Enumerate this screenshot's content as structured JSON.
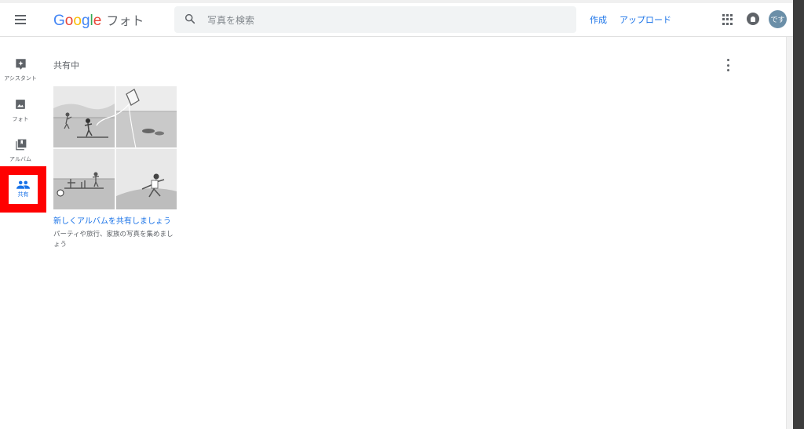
{
  "header": {
    "logo_letters": [
      {
        "ch": "G",
        "color": "#4285f4"
      },
      {
        "ch": "o",
        "color": "#ea4335"
      },
      {
        "ch": "o",
        "color": "#fbbc05"
      },
      {
        "ch": "g",
        "color": "#4285f4"
      },
      {
        "ch": "l",
        "color": "#34a853"
      },
      {
        "ch": "e",
        "color": "#ea4335"
      }
    ],
    "product_name": "フォト",
    "search_placeholder": "写真を検索",
    "create_label": "作成",
    "upload_label": "アップロード",
    "avatar_text": "です"
  },
  "sidebar": {
    "items": [
      {
        "label": "アシスタント",
        "icon": "assistant-icon"
      },
      {
        "label": "フォト",
        "icon": "photo-icon"
      },
      {
        "label": "アルバム",
        "icon": "album-icon"
      },
      {
        "label": "共有",
        "icon": "people-icon",
        "selected": true
      }
    ]
  },
  "main": {
    "section_title": "共有中",
    "card": {
      "title": "新しくアルバムを共有しましょう",
      "subtitle": "パーティや旅行、家族の写真を集めましょう"
    }
  },
  "colors": {
    "accent": "#1a73e8",
    "highlight": "#ff0000"
  }
}
